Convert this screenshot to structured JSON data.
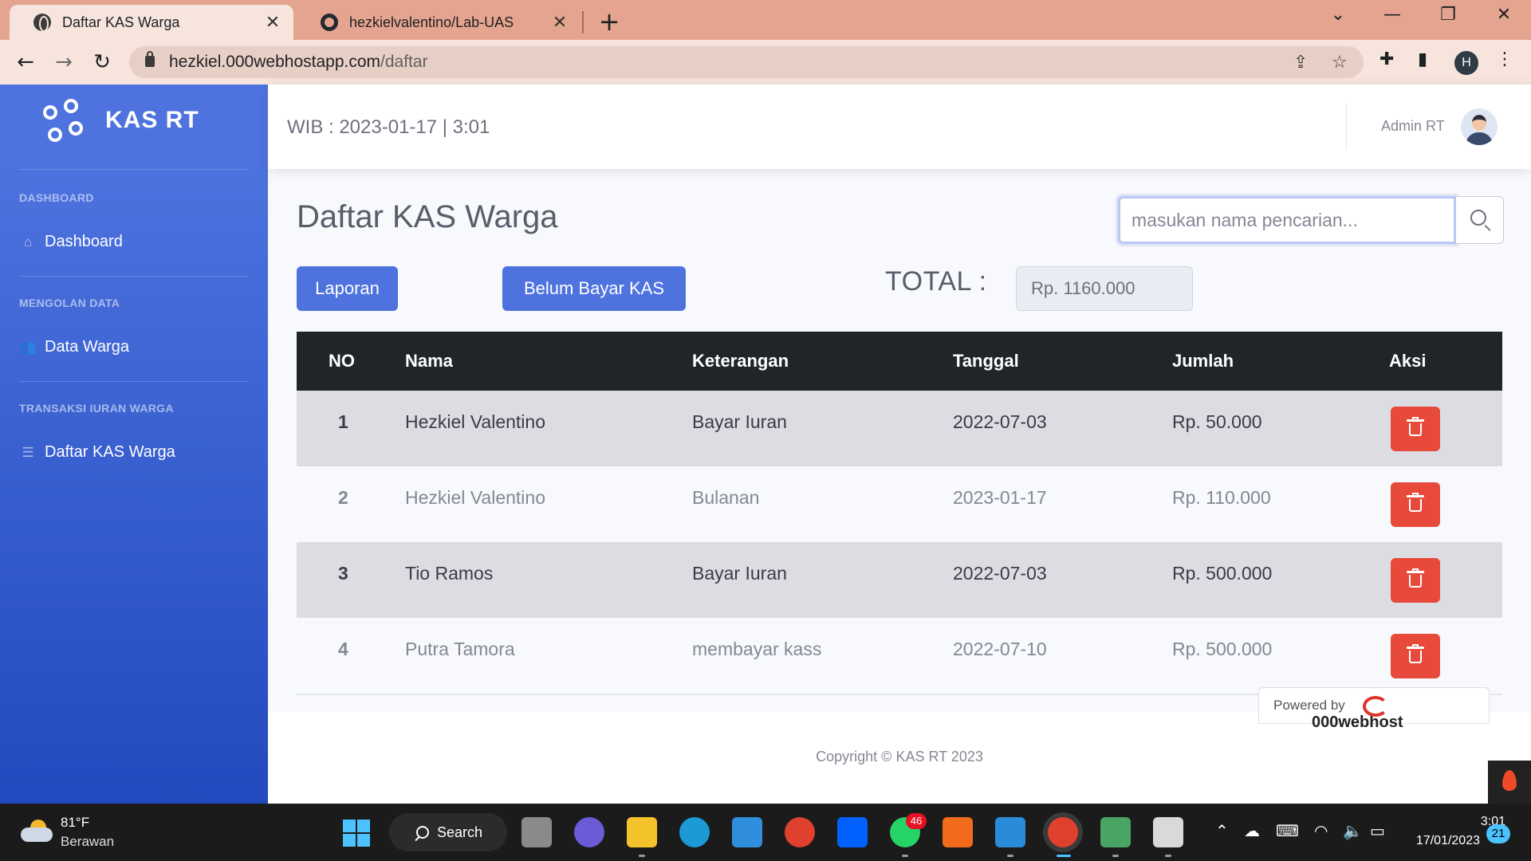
{
  "browser": {
    "tabs": [
      {
        "title": "Daftar KAS Warga",
        "active": true
      },
      {
        "title": "hezkielvalentino/Lab-UAS",
        "active": false
      }
    ],
    "url_host": "hezkiel.000webhostapp.com",
    "url_path": "/daftar",
    "profile_initial": "H"
  },
  "sidebar": {
    "brand": "KAS RT",
    "sections": [
      {
        "heading": "DASHBOARD",
        "item": "Dashboard",
        "icon": "home-icon"
      },
      {
        "heading": "MENGOLAN DATA",
        "item": "Data Warga",
        "icon": "users-icon"
      },
      {
        "heading": "TRANSAKSI IURAN WARGA",
        "item": "Daftar KAS Warga",
        "icon": "list-icon"
      }
    ]
  },
  "topbar": {
    "clock": "WIB : 2023-01-17 | 3:01",
    "user": "Admin RT"
  },
  "main": {
    "title": "Daftar KAS Warga",
    "search_placeholder": "masukan nama pencarian...",
    "btn_laporan": "Laporan",
    "btn_belum": "Belum Bayar KAS",
    "total_label": "TOTAL :",
    "total_value": "Rp. 1160.000"
  },
  "table": {
    "headers": [
      "NO",
      "Nama",
      "Keterangan",
      "Tanggal",
      "Jumlah",
      "Aksi"
    ],
    "rows": [
      {
        "no": "1",
        "nama": "Hezkiel Valentino",
        "ket": "Bayar Iuran",
        "tgl": "2022-07-03",
        "jml": "Rp. 50.000"
      },
      {
        "no": "2",
        "nama": "Hezkiel Valentino",
        "ket": "Bulanan",
        "tgl": "2023-01-17",
        "jml": "Rp. 110.000"
      },
      {
        "no": "3",
        "nama": "Tio Ramos",
        "ket": "Bayar Iuran",
        "tgl": "2022-07-03",
        "jml": "Rp. 500.000"
      },
      {
        "no": "4",
        "nama": "Putra Tamora",
        "ket": "membayar kass",
        "tgl": "2022-07-10",
        "jml": "Rp. 500.000"
      }
    ]
  },
  "footer": {
    "copyright": "Copyright © KAS RT 2023",
    "powered_by": "Powered by",
    "host_brand": "000webhost"
  },
  "taskbar": {
    "temp": "81°F",
    "weather": "Berawan",
    "search": "Search",
    "whatsapp_badge": "46",
    "time": "3:01",
    "date": "17/01/2023",
    "notifications": "21"
  },
  "colors": {
    "primary": "#4e73df",
    "danger": "#e74a3b",
    "table_header": "#212529"
  }
}
